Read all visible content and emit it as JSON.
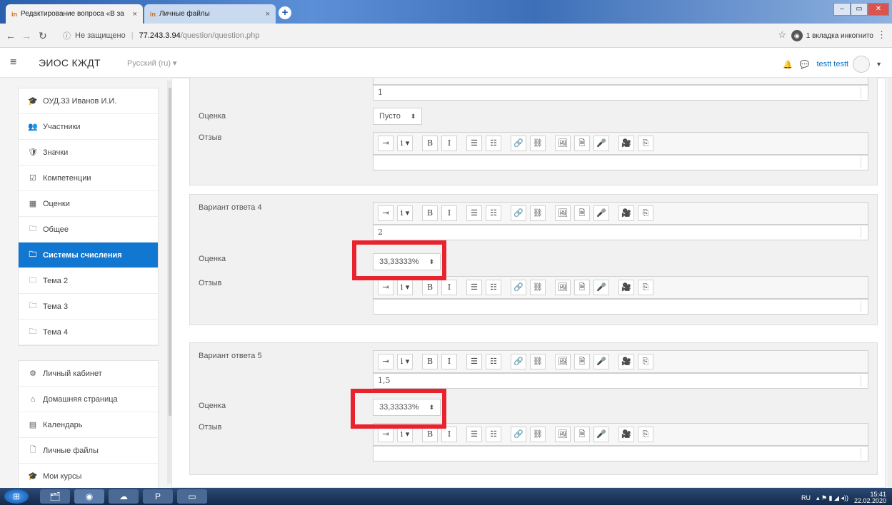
{
  "browser": {
    "tabs": [
      {
        "favicon": "in",
        "title": "Редактирование вопроса «В за",
        "close": "×"
      },
      {
        "favicon": "in",
        "title": "Личные файлы",
        "close": "×"
      }
    ],
    "new_tab": "+",
    "url_security": "Не защищено",
    "url_host": "77.243.3.94",
    "url_path": "/question/question.php",
    "incognito_label": "1 вкладка инкогнито"
  },
  "site": {
    "brand": "ЭИОС КЖДТ",
    "language": "Русский (ru) ▾",
    "user_name": "testt testt"
  },
  "drawer": {
    "items": [
      {
        "icon": "graduation-cap-icon",
        "glyph": "🎓",
        "label": "ОУД.33 Иванов И.И."
      },
      {
        "icon": "users-icon",
        "glyph": "👥",
        "label": "Участники"
      },
      {
        "icon": "badge-icon",
        "glyph": "🛡",
        "label": "Значки"
      },
      {
        "icon": "competency-icon",
        "glyph": "☑",
        "label": "Компетенции"
      },
      {
        "icon": "grades-icon",
        "glyph": "▦",
        "label": "Оценки"
      },
      {
        "icon": "folder-icon",
        "glyph": "🗀",
        "label": "Общее"
      },
      {
        "icon": "folder-icon",
        "glyph": "🗀",
        "label": "Системы счисления",
        "active": true
      },
      {
        "icon": "folder-icon",
        "glyph": "🗀",
        "label": "Тема 2"
      },
      {
        "icon": "folder-icon",
        "glyph": "🗀",
        "label": "Тема 3"
      },
      {
        "icon": "folder-icon",
        "glyph": "🗀",
        "label": "Тема 4"
      }
    ],
    "items2": [
      {
        "icon": "dashboard-icon",
        "glyph": "⚙",
        "label": "Личный кабинет"
      },
      {
        "icon": "home-icon",
        "glyph": "⌂",
        "label": "Домашняя страница"
      },
      {
        "icon": "calendar-icon",
        "glyph": "▤",
        "label": "Календарь"
      },
      {
        "icon": "file-icon",
        "glyph": "🗋",
        "label": "Личные файлы"
      },
      {
        "icon": "courses-icon",
        "glyph": "🎓",
        "label": "Мои курсы"
      }
    ]
  },
  "form": {
    "grade_label": "Оценка",
    "feedback_label": "Отзыв",
    "answer3": {
      "text": "1",
      "grade": "Пусто"
    },
    "answer4": {
      "label": "Вариант ответа 4",
      "text": "2",
      "grade": "33,33333%"
    },
    "answer5": {
      "label": "Вариант ответа 5",
      "text": "1,5",
      "grade": "33,33333%"
    }
  },
  "toolbar_buttons": [
    "⇥",
    "i ▾",
    "B",
    "I",
    "☰",
    "☷",
    "🔗",
    "⛓",
    "🖼",
    "🗎",
    "🎤",
    "🎥",
    "⎘"
  ],
  "taskbar": {
    "lang": "RU",
    "time": "15:41",
    "date": "22.02.2020"
  }
}
